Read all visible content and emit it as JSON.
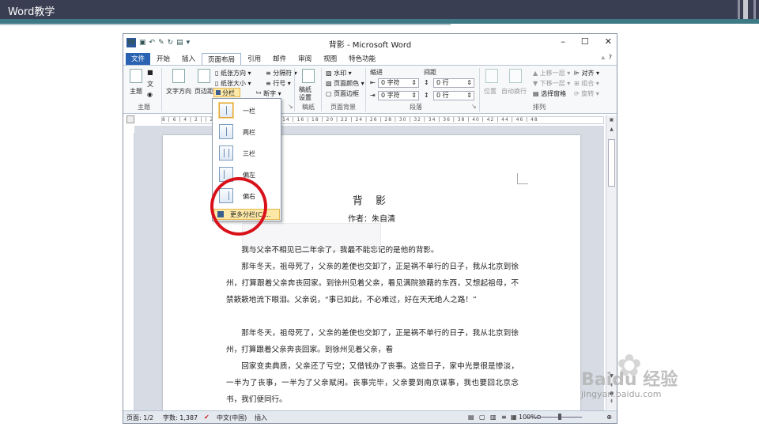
{
  "slide": {
    "title": "Word教学"
  },
  "window": {
    "title": "背影 - Microsoft Word",
    "controls": [
      "–",
      "☐",
      "✕"
    ]
  },
  "tabs": [
    {
      "label": "文件",
      "kind": "file"
    },
    {
      "label": "开始"
    },
    {
      "label": "插入"
    },
    {
      "label": "页面布局",
      "kind": "active"
    },
    {
      "label": "引用"
    },
    {
      "label": "邮件"
    },
    {
      "label": "审阅"
    },
    {
      "label": "视图"
    },
    {
      "label": "特色功能"
    }
  ],
  "ribbon": {
    "theme": {
      "btn": "主题",
      "group": "主题"
    },
    "page_setup": {
      "text_dir": "文字方向",
      "margins": "页边距",
      "orientation": "纸张方向",
      "size": "纸张大小",
      "columns": "分栏",
      "breaks": "分隔符",
      "line_numbers": "行号",
      "hyphenation": "断字"
    },
    "draft": {
      "btn": "稿纸\n设置",
      "group": "稿纸"
    },
    "background": {
      "watermark": "水印",
      "page_color": "页面颜色",
      "border": "页面边框",
      "group": "页面背景"
    },
    "paragraph": {
      "indent_label": "缩进",
      "spacing_label": "间距",
      "indent_left": "0 字符",
      "indent_right": "0 字符",
      "space_before": "0 行",
      "space_after": "0 行",
      "group": "段落"
    },
    "arrange": {
      "position": "位置",
      "wrap": "自动换行",
      "bring_forward": "上移一层",
      "send_backward": "下移一层",
      "selection_pane": "选择窗格",
      "align": "对齐",
      "group_btn": "组合",
      "rotate": "旋转",
      "group": "排列"
    }
  },
  "columns_menu": {
    "items": [
      "一栏",
      "两栏",
      "三栏",
      "偏左",
      "偏右"
    ],
    "more": "更多分栏(C)..."
  },
  "ruler_text": "8 | 6 | 4 | 2 |   | 2 | 4 | 6 | 8 | 10 | 12 | 14 | 16 | 18 | 20 | 22 | 24 | 26 | 28 | 30 | 32 | 34 | 36 | 38 | 40 | 42 | 44 | 46 | 48",
  "document": {
    "title": "背  影",
    "author": "作者：朱自清",
    "paragraphs": [
      "我与父亲不相见已二年余了，我最不能忘记的是他的背影。",
      "那年冬天，祖母死了，父亲的差使也交卸了，正是祸不单行的日子，我从北京到徐州，打算跟着父亲奔丧回家。到徐州见着父亲，看见满院狼藉的东西，又想起祖母，不禁簌簌地流下眼泪。父亲说，“事已如此，不必难过，好在天无绝人之路！”",
      "那年冬天，祖母死了，父亲的差使也交卸了，正是祸不单行的日子，我从北京到徐州，打算跟着父亲奔丧回家。到徐州见着父亲，看",
      "回家变卖典质，父亲还了亏空；又借钱办了丧事。这些日子，家中光景很是惨淡，一半为了丧事，一半为了父亲赋闲。丧事完毕，父亲要到南京谋事，我也要回北京念书，我们便同行。"
    ]
  },
  "status": {
    "page": "页面: 1/2",
    "words": "字数: 1,387",
    "lang": "中文(中国)",
    "mode": "插入",
    "zoom": "100%"
  },
  "watermark": {
    "brand": "Baidu 经验",
    "url": "jingyan.baidu.com"
  }
}
